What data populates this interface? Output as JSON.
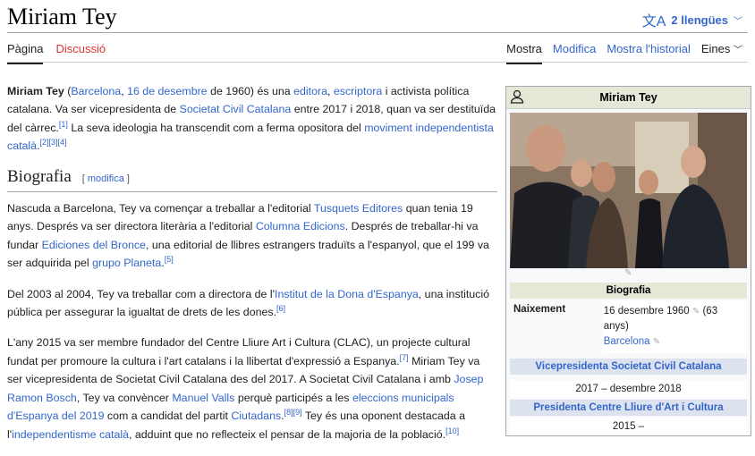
{
  "page": {
    "title": "Miriam Tey"
  },
  "languages": {
    "label": "2 llengües"
  },
  "tabs": {
    "pagina": "Pàgina",
    "discussio": "Discussió",
    "mostra": "Mostra",
    "modifica": "Modifica",
    "historial": "Mostra l'historial",
    "eines": "Eines"
  },
  "intro": {
    "name": "Miriam Tey",
    "t1": " (",
    "l_barcelona": "Barcelona",
    "t2": ", ",
    "l_date": "16 de desembre",
    "t3": " de 1960) és una ",
    "l_editora": "editora",
    "t4": ", ",
    "l_escriptora": "escriptora",
    "t5": " i activista política catalana. Va ser vicepresidenta de ",
    "l_scc": "Societat Civil Catalana",
    "t6": " entre 2017 i 2018, quan va ser destituïda del càrrec.",
    "r1": "[1]",
    "t7": " La seva ideologia ha transcendit com a ferma opositora del ",
    "l_mov": "moviment independentista català",
    "t8": ".",
    "r2": "[2][3][4]"
  },
  "section": {
    "title": "Biografia",
    "edit_open": "[ ",
    "edit": "modifica",
    "edit_close": " ]"
  },
  "p1": {
    "a": "Nascuda a Barcelona, Tey va començar a treballar a l'editorial ",
    "l1": "Tusquets Editores",
    "b": " quan tenia 19 anys. Després va ser directora literària a l'editorial ",
    "l2": "Columna Edicions",
    "c": ". Després de treballar-hi va fundar ",
    "l3": "Ediciones del Bronce",
    "d": ", una editorial de llibres estrangers traduïts a l'espanyol, que el 199 va ser adquirida pel ",
    "l4": "grupo Planeta",
    "e": ".",
    "r": "[5]"
  },
  "p2": {
    "a": "Del 2003 al 2004, Tey va treballar com a directora de l'",
    "l1": "Institut de la Dona d'Espanya",
    "b": ", una institució pública per assegurar la igualtat de drets de les dones.",
    "r": "[6]"
  },
  "p3": {
    "a": "L'any 2015 va ser membre fundador del Centre Lliure Art i Cultura (CLAC), un projecte cultural fundat per promoure la cultura i l'art catalans i la llibertat d'expressió a Espanya.",
    "r1": "[7]",
    "b": " Miriam Tey va ser vicepresidenta de Societat Civil Catalana des del 2017. A Societat Civil Catalana i amb ",
    "l1": "Josep Ramon Bosch",
    "c": ", Tey va convèncer ",
    "l2": "Manuel Valls",
    "d": " perquè participés a les ",
    "l3": "eleccions municipals d'Espanya del 2019",
    "e": " com a candidat del partit ",
    "l4": "Ciutadans",
    "f": ".",
    "r2": "[8][9]",
    "g": " Tey és una oponent destacada a l'",
    "l5": "independentisme català",
    "h": ", adduint que no reflecteix el pensar de la majoria de la població.",
    "r3": "[10]"
  },
  "infobox": {
    "title": "Miriam Tey",
    "section": "Biografia",
    "birth_label": "Naixement",
    "birth_date": "16 desembre 1960",
    "birth_age": "(63 anys)",
    "birth_place": "Barcelona",
    "role1": "Vicepresidenta Societat Civil Catalana",
    "role1_period": "2017 – desembre 2018",
    "role2": "Presidenta Centre Lliure d'Art i Cultura",
    "role2_period": "2015 –"
  }
}
